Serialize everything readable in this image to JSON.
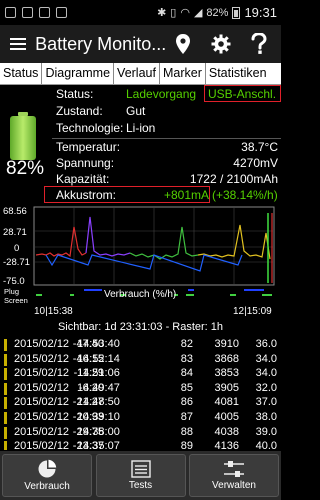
{
  "statusbar": {
    "battery_percent": "82%",
    "time": "19:31"
  },
  "appbar": {
    "title": "Battery Monito..."
  },
  "tabs": [
    "Status",
    "Diagramme",
    "Verlauf",
    "Marker",
    "Statistiken"
  ],
  "info": {
    "battery_percent": "82%",
    "status_label": "Status:",
    "status_value": "Ladevorgang",
    "status_source": "USB-Anschl.",
    "zustand_label": "Zustand:",
    "zustand_value": "Gut",
    "technologie_label": "Technologie:",
    "technologie_value": "Li-ion",
    "temperatur_label": "Temperatur:",
    "temperatur_value": "38.7°C",
    "spannung_label": "Spannung:",
    "spannung_value": "4270mV",
    "kapazitaet_label": "Kapazität:",
    "kapazitaet_value": "1722 / 2100mAh",
    "akkustrom_label": "Akkustrom:",
    "akkustrom_value": "+801mA",
    "akkustrom_pct": "(+38.14%/h)"
  },
  "chart": {
    "y_ticks": [
      "68.56",
      "28.71",
      "0",
      "-28.71",
      "-75.0"
    ],
    "left_labels": [
      "Plug",
      "Screen"
    ],
    "x_start": "10|15:38",
    "x_label": "Verbrauch (%/h)",
    "x_end": "12|15:09"
  },
  "sichtbar": "Sichtbar: 1d 23:31:03 - Raster: 1h",
  "table_rows": [
    [
      "2015/02/12",
      "14:53:40",
      "-47.40",
      "82",
      "3910",
      "36.0"
    ],
    [
      "2015/02/12",
      "14:52:14",
      "-46.15",
      "83",
      "3868",
      "34.0"
    ],
    [
      "2015/02/12",
      "14:51:06",
      "-11.29",
      "84",
      "3853",
      "34.0"
    ],
    [
      "2015/02/12",
      "14:49:47",
      "-6.20",
      "85",
      "3905",
      "32.0"
    ],
    [
      "2015/02/12",
      "14:48:50",
      "-21.27",
      "86",
      "4081",
      "37.0"
    ],
    [
      "2015/02/12",
      "14:39:10",
      "-20.93",
      "87",
      "4005",
      "38.0"
    ],
    [
      "2015/02/12",
      "14:38:00",
      "-29.75",
      "88",
      "4038",
      "39.0"
    ],
    [
      "2015/02/12",
      "14:35:07",
      "-23.37",
      "89",
      "4136",
      "40.0"
    ]
  ],
  "bottombar": {
    "verbrauch": "Verbrauch",
    "tests": "Tests",
    "verwalten": "Verwalten"
  },
  "colors": {
    "accent_green": "#55d000",
    "highlight_red": "#e0202a"
  }
}
